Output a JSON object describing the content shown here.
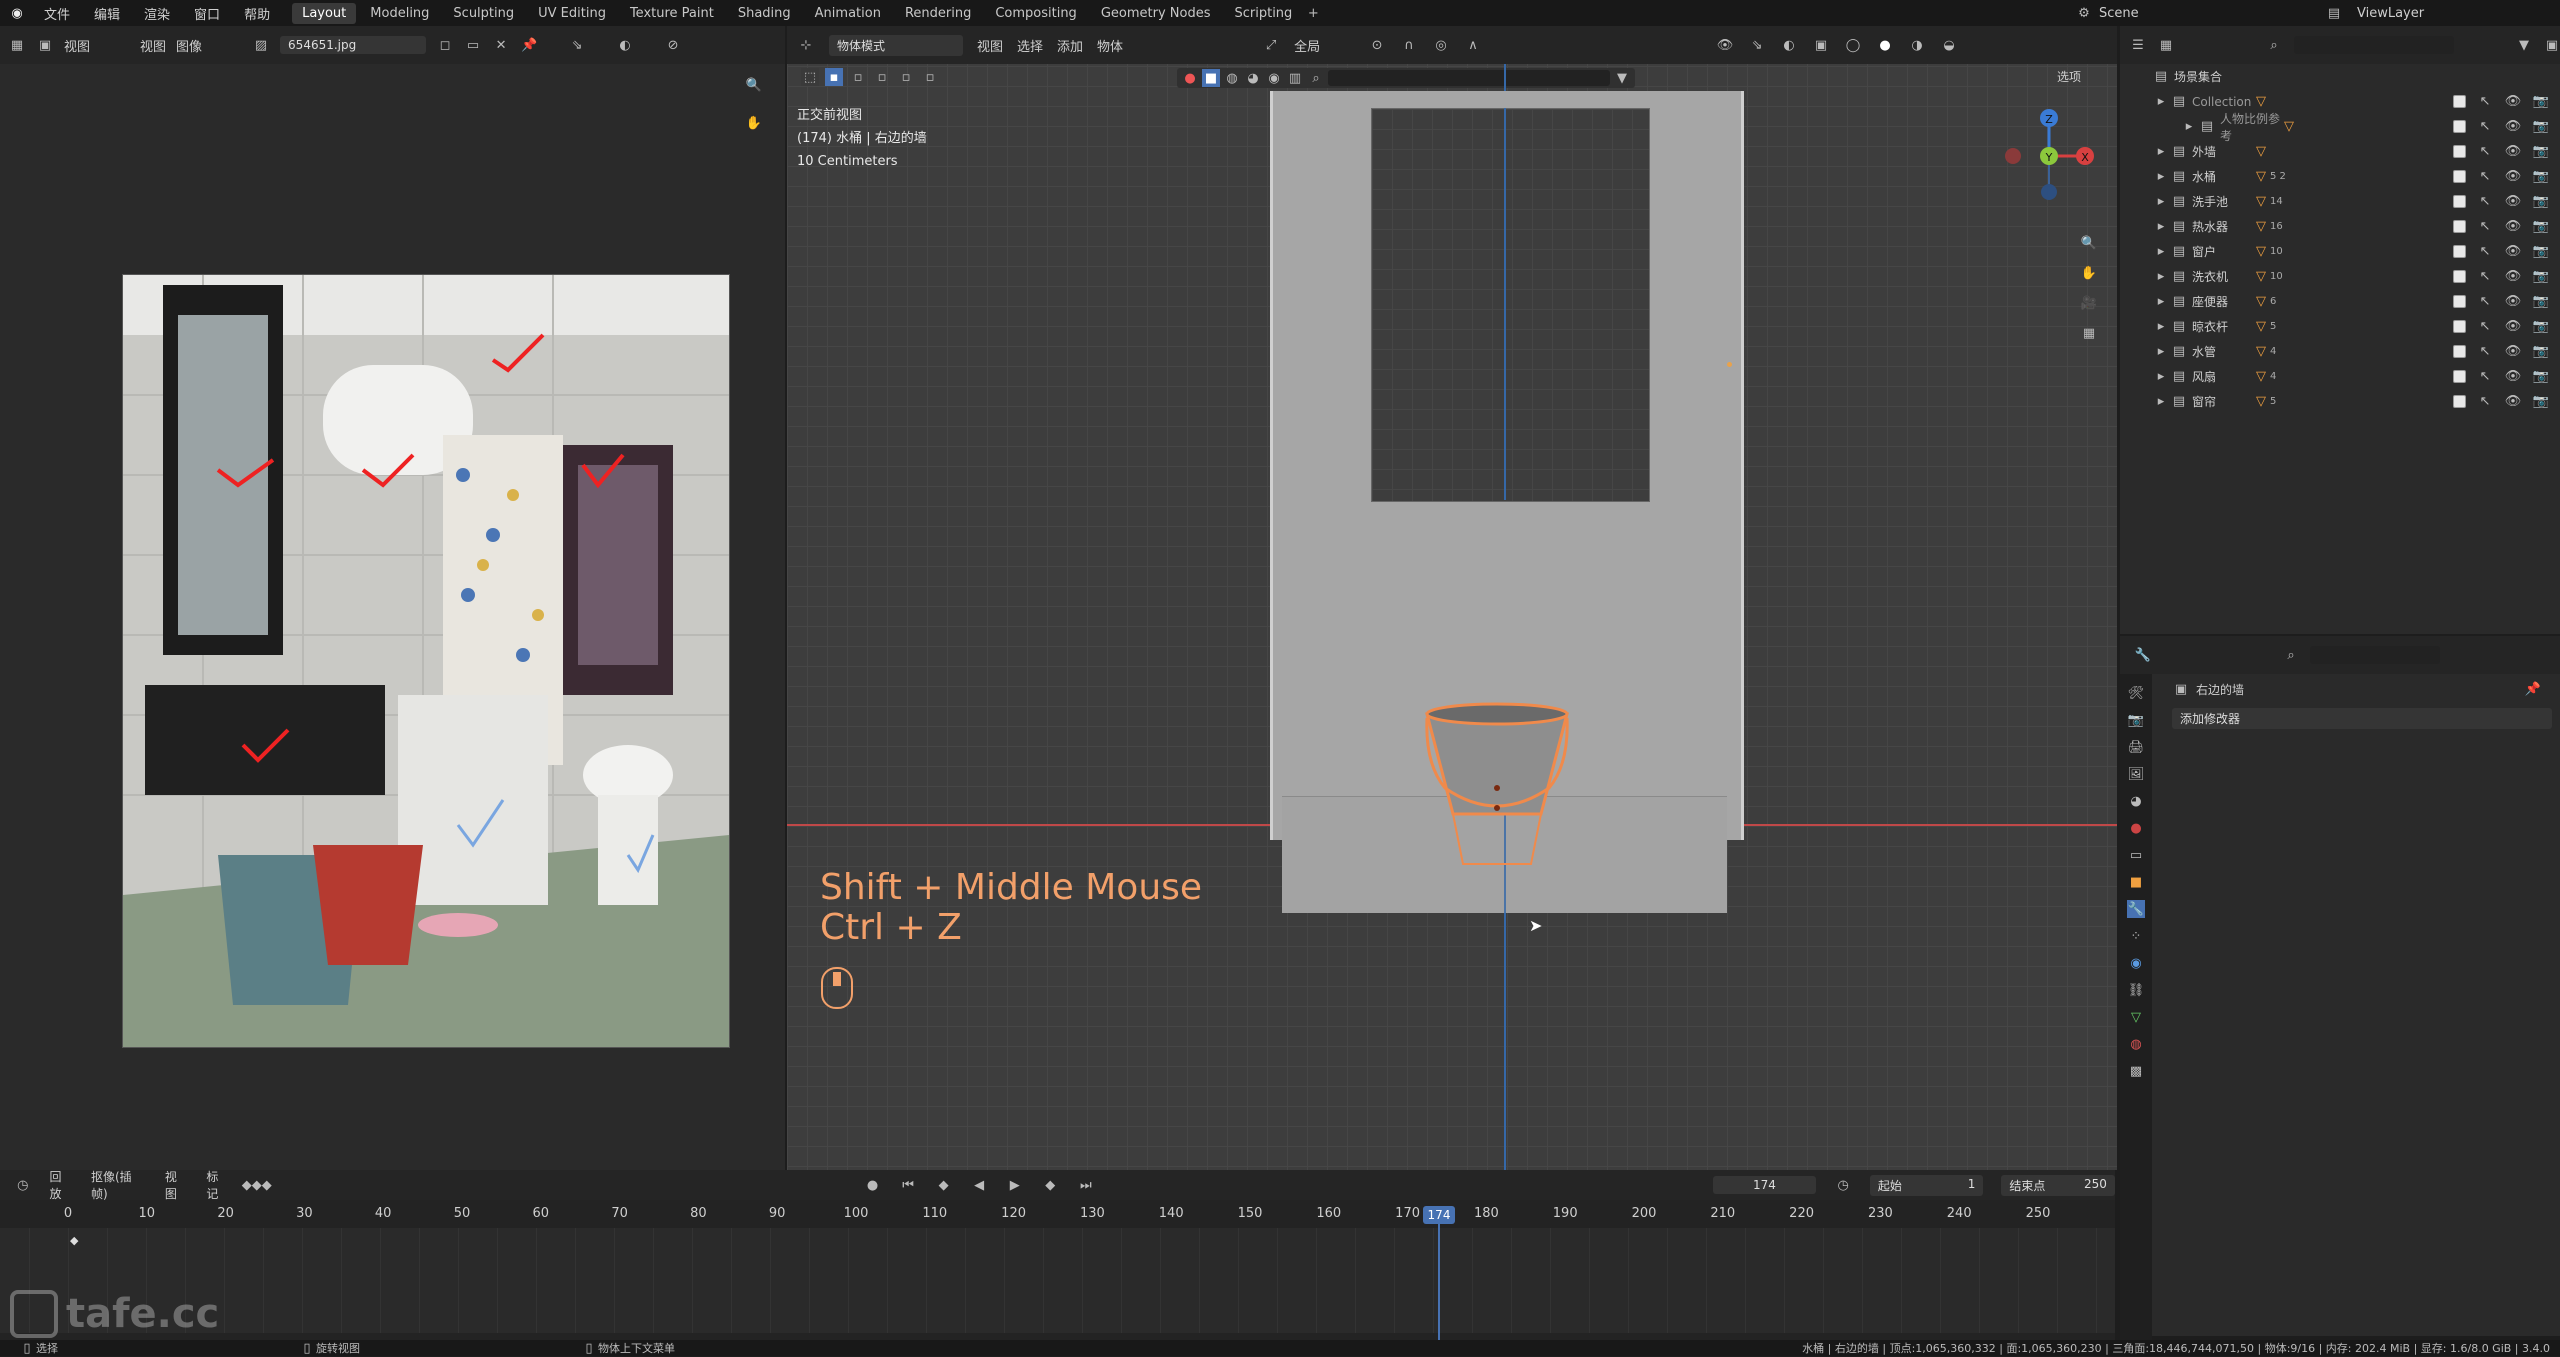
{
  "menu": {
    "file": "文件",
    "edit": "编辑",
    "render": "渲染",
    "window": "窗口",
    "help": "帮助"
  },
  "workspaces": [
    "Layout",
    "Modeling",
    "Sculpting",
    "UV Editing",
    "Texture Paint",
    "Shading",
    "Animation",
    "Rendering",
    "Compositing",
    "Geometry Nodes",
    "Scripting"
  ],
  "scene": {
    "name": "Scene",
    "view_layer": "ViewLayer"
  },
  "image_editor": {
    "view": "视图",
    "view2": "视图",
    "image": "图像",
    "filename": "654651.jpg"
  },
  "viewport": {
    "mode": "物体模式",
    "menu": [
      "视图",
      "选择",
      "添加",
      "物体"
    ],
    "transform": "全局",
    "options": "选项",
    "overlay_lines": [
      "正交前视图",
      "(174) 水桶 | 右边的墙",
      "10 Centimeters"
    ],
    "hint_lines": [
      "Shift + Middle Mouse",
      "Ctrl + Z"
    ],
    "gizmo": {
      "z": "Z",
      "y": "Y",
      "x": "X"
    }
  },
  "outliner": {
    "root": "场景集合",
    "items": [
      {
        "name": "Collection",
        "count": ""
      },
      {
        "name": "人物比例参考",
        "count": ""
      },
      {
        "name": "外墙",
        "count": ""
      },
      {
        "name": "水桶",
        "count": "5 2"
      },
      {
        "name": "洗手池",
        "count": "14"
      },
      {
        "name": "热水器",
        "count": "16"
      },
      {
        "name": "窗户",
        "count": "10"
      },
      {
        "name": "洗衣机",
        "count": "10"
      },
      {
        "name": "座便器",
        "count": "6"
      },
      {
        "name": "晾衣杆",
        "count": "5"
      },
      {
        "name": "水管",
        "count": "4"
      },
      {
        "name": "风扇",
        "count": "4"
      },
      {
        "name": "窗帘",
        "count": "5"
      }
    ]
  },
  "properties": {
    "object": "右边的墙",
    "add_modifier": "添加修改器"
  },
  "timeline": {
    "playback": "回放",
    "keying": "抠像(插帧)",
    "view": "视图",
    "marker": "标记",
    "current_frame": "174",
    "start_label": "起始",
    "start": "1",
    "end_label": "结束点",
    "end": "250",
    "ticks": [
      "0",
      "10",
      "20",
      "30",
      "40",
      "50",
      "60",
      "70",
      "80",
      "90",
      "100",
      "110",
      "120",
      "130",
      "140",
      "150",
      "160",
      "170",
      "180",
      "190",
      "200",
      "210",
      "220",
      "230",
      "240",
      "250"
    ],
    "playhead": "174"
  },
  "statusbar": {
    "select": "选择",
    "rotate": "旋转视图",
    "context": "物体上下文菜单",
    "stats": "水桶 | 右边的墙 | 顶点:1,065,360,332 | 面:1,065,360,230 | 三角面:18,446,744,071,50 | 物体:9/16 | 内存: 202.4 MiB | 显存: 1.6/8.0 GiB | 3.4.0"
  },
  "watermark": "tafe.cc",
  "colors": {
    "accent": "#4772b3",
    "select": "#f08a4b",
    "xaxis": "#d84040",
    "yaxis": "#8cc83c",
    "zaxis": "#3a7bd5"
  }
}
